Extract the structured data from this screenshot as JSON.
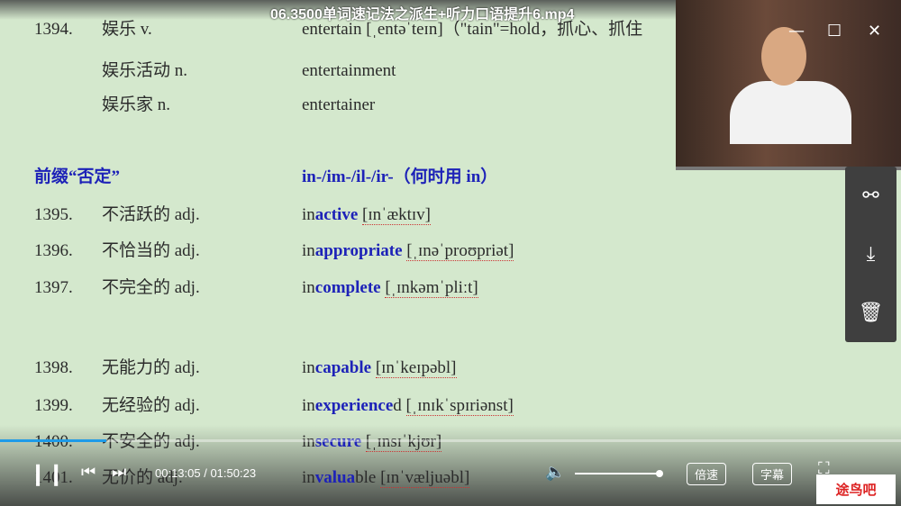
{
  "player": {
    "title": "06.3500单词速记法之派生+听力口语提升6.mp4",
    "time": "00:13:05 / 01:50:23",
    "progress_percent": 11.8,
    "volume_percent": 100,
    "speed_label": "倍速",
    "subtitle_label": "字幕",
    "watermark": "途鸟吧"
  },
  "slide": {
    "top": [
      {
        "num": "1394.",
        "cn": "娱乐 v.",
        "en": "entertain [ˌentəˈteɪn]（\"tain\"=hold，抓心、抓住"
      },
      {
        "num": "",
        "cn": "娱乐活动 n.",
        "en": "entertainment"
      },
      {
        "num": "",
        "cn": "娱乐家 n.",
        "en": "entertainer"
      }
    ],
    "heading_cn": "前缀“否定”",
    "heading_en": "in-/im-/il-/ir-（何时用 in）",
    "words": [
      {
        "num": "1395.",
        "cn": "不活跃的 adj.",
        "pre": "in",
        "stem": "active",
        "post": "",
        "ipa": "[ɪnˈæktɪv]"
      },
      {
        "num": "1396.",
        "cn": "不恰当的 adj.",
        "pre": "in",
        "stem": "appropriate",
        "post": "",
        "ipa": "[ˌɪnəˈproʊpriət]"
      },
      {
        "num": "1397.",
        "cn": "不完全的 adj.",
        "pre": "in",
        "stem": "complete",
        "post": "",
        "ipa": "[ˌɪnkəmˈpliːt]"
      },
      {
        "num": "1398.",
        "cn": "无能力的 adj.",
        "pre": "in",
        "stem": "capable",
        "post": "",
        "ipa": "[ɪnˈkeɪpəbl]"
      },
      {
        "num": "1399.",
        "cn": "无经验的 adj.",
        "pre": "in",
        "stem": "experience",
        "post": "d",
        "ipa": "[ˌɪnɪkˈspɪriənst]"
      },
      {
        "num": "1400.",
        "cn": "不安全的 adj.",
        "pre": "in",
        "stem": "secure",
        "post": "",
        "ipa": "[ˌɪnsɪˈkjʊr]"
      },
      {
        "num": "1401.",
        "cn": "无价的 adj.",
        "pre": "in",
        "stem": "valua",
        "post": "ble",
        "ipa": "[ɪnˈvæljuəbl]"
      }
    ]
  }
}
